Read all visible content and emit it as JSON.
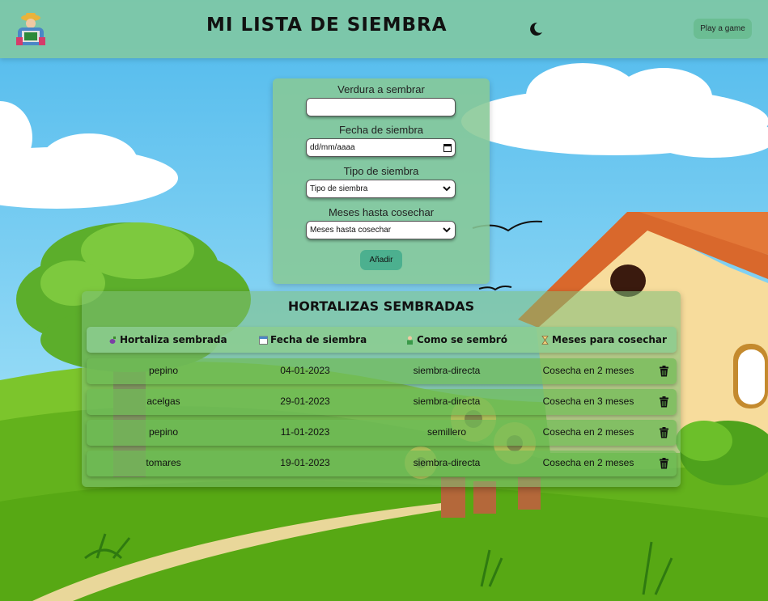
{
  "header": {
    "title": "MI LISTA DE SIEMBRA",
    "game_button": "Play a game"
  },
  "form": {
    "vegetable_label": "Verdura a sembrar",
    "vegetable_value": "",
    "date_label": "Fecha de siembra",
    "date_placeholder": "dd/mm/aaaa",
    "type_label": "Tipo de siembra",
    "type_selected": "Tipo de siembra",
    "months_label": "Meses hasta cosechar",
    "months_selected": "Meses hasta cosechar",
    "add_button": "Añadir"
  },
  "table": {
    "title": "HORTALIZAS SEMBRADAS",
    "headers": [
      "Hortaliza sembrada",
      "Fecha de siembra",
      "Como se sembró",
      "Meses para cosechar"
    ],
    "rows": [
      {
        "vegetable": "pepino",
        "date": "04-01-2023",
        "method": "siembra-directa",
        "harvest": "Cosecha en 2 meses"
      },
      {
        "vegetable": "acelgas",
        "date": "29-01-2023",
        "method": "siembra-directa",
        "harvest": "Cosecha en 3 meses"
      },
      {
        "vegetable": "pepino",
        "date": "11-01-2023",
        "method": "semillero",
        "harvest": "Cosecha en 2 meses"
      },
      {
        "vegetable": "tomares",
        "date": "19-01-2023",
        "method": "siembra-directa",
        "harvest": "Cosecha en 2 meses"
      }
    ]
  },
  "icons": {
    "logo": "farmer-logo",
    "theme_toggle": "moon-icon",
    "header_icons": [
      "eggplant-icon",
      "calendar-icon",
      "farmer-icon",
      "hourglass-icon"
    ],
    "row_action": "trash-icon"
  },
  "colors": {
    "header_bg": "#82c8a0",
    "accent_button": "#4cb08f",
    "game_button": "#6bbd93"
  }
}
